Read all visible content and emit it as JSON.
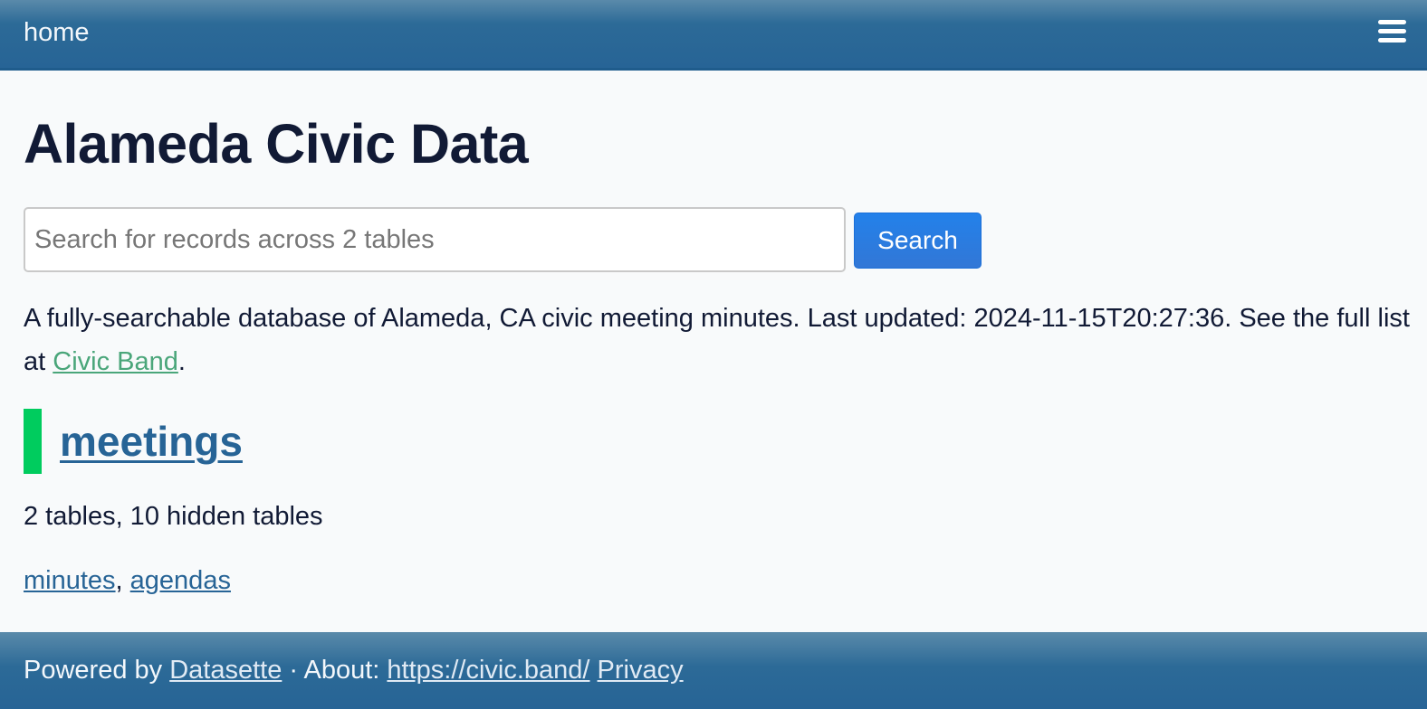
{
  "header": {
    "home_label": "home",
    "menu_icon": "hamburger-menu-icon"
  },
  "page": {
    "title": "Alameda Civic Data"
  },
  "search": {
    "placeholder": "Search for records across 2 tables",
    "value": "",
    "button_label": "Search"
  },
  "description": {
    "text_before": "A fully-searchable database of Alameda, CA civic meeting minutes. Last updated: 2024-11-15T20:27:36. See the full list at ",
    "link_label": "Civic Band",
    "text_after": "."
  },
  "database": {
    "name": "meetings",
    "accent_color": "#00cc5e",
    "summary": "2 tables, 10 hidden tables",
    "tables": [
      {
        "label": "minutes"
      },
      {
        "label": "agendas"
      }
    ],
    "separator": ", "
  },
  "footer": {
    "powered_by": "Powered by ",
    "datasette_label": "Datasette",
    "about_prefix": " · About: ",
    "about_link": "https://civic.band/",
    "privacy_label": "Privacy"
  }
}
